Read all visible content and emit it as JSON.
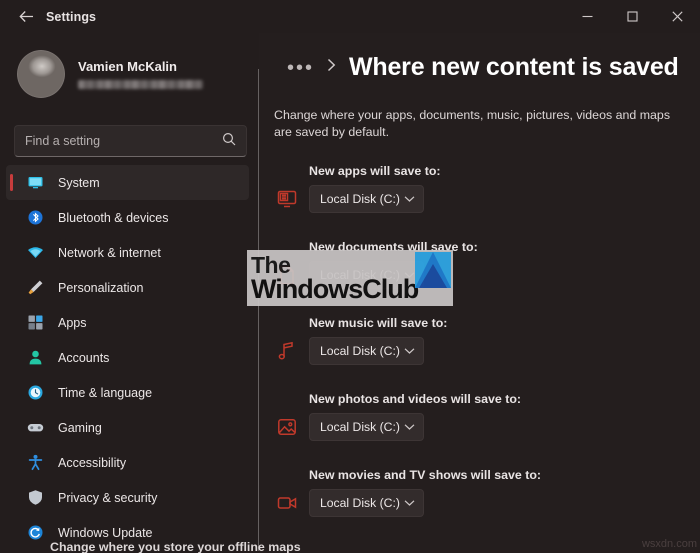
{
  "window": {
    "app_title": "Settings",
    "back_icon": "back-arrow-icon",
    "minimize_label": "—",
    "maximize_label": "☐",
    "close_label": "✕"
  },
  "sidebar": {
    "user": {
      "name": "Vamien McKalin",
      "email_redacted": ""
    },
    "search": {
      "placeholder": "Find a setting",
      "value": "",
      "icon": "search-icon"
    },
    "items": [
      {
        "label": "System",
        "icon": "monitor-icon",
        "selected": true
      },
      {
        "label": "Bluetooth & devices",
        "icon": "bluetooth-icon",
        "selected": false
      },
      {
        "label": "Network & internet",
        "icon": "wifi-icon",
        "selected": false
      },
      {
        "label": "Personalization",
        "icon": "paintbrush-icon",
        "selected": false
      },
      {
        "label": "Apps",
        "icon": "apps-grid-icon",
        "selected": false
      },
      {
        "label": "Accounts",
        "icon": "person-icon",
        "selected": false
      },
      {
        "label": "Time & language",
        "icon": "clock-icon",
        "selected": false
      },
      {
        "label": "Gaming",
        "icon": "gamepad-icon",
        "selected": false
      },
      {
        "label": "Accessibility",
        "icon": "accessibility-icon",
        "selected": false
      },
      {
        "label": "Privacy & security",
        "icon": "shield-icon",
        "selected": false
      },
      {
        "label": "Windows Update",
        "icon": "refresh-icon",
        "selected": false
      }
    ]
  },
  "main": {
    "breadcrumb_dots": "•••",
    "title": "Where new content is saved",
    "description": "Change where your apps, documents, music, pictures, videos and maps are saved by default.",
    "rows": [
      {
        "label": "New apps will save to:",
        "icon": "app-monitor-icon",
        "value": "Local Disk (C:)"
      },
      {
        "label": "New documents will save to:",
        "icon": "document-icon",
        "value": "Local Disk (C:)"
      },
      {
        "label": "New music will save to:",
        "icon": "music-note-icon",
        "value": "Local Disk (C:)"
      },
      {
        "label": "New photos and videos will save to:",
        "icon": "photo-icon",
        "value": "Local Disk (C:)"
      },
      {
        "label": "New movies and TV shows will save to:",
        "icon": "video-camera-icon",
        "value": "Local Disk (C:)"
      }
    ],
    "footer_note": "Change where you store your offline maps"
  },
  "watermarks": {
    "brand_line1": "The",
    "brand_line2": "WindowsClub",
    "corner": "wsxdn.com"
  },
  "colors": {
    "window_bg": "#241e1e",
    "sidebar_bg": "#231d1d",
    "accent_selected": "#c73c3c",
    "content_icon_red": "#c0392b",
    "text_primary": "#ece7e7"
  }
}
